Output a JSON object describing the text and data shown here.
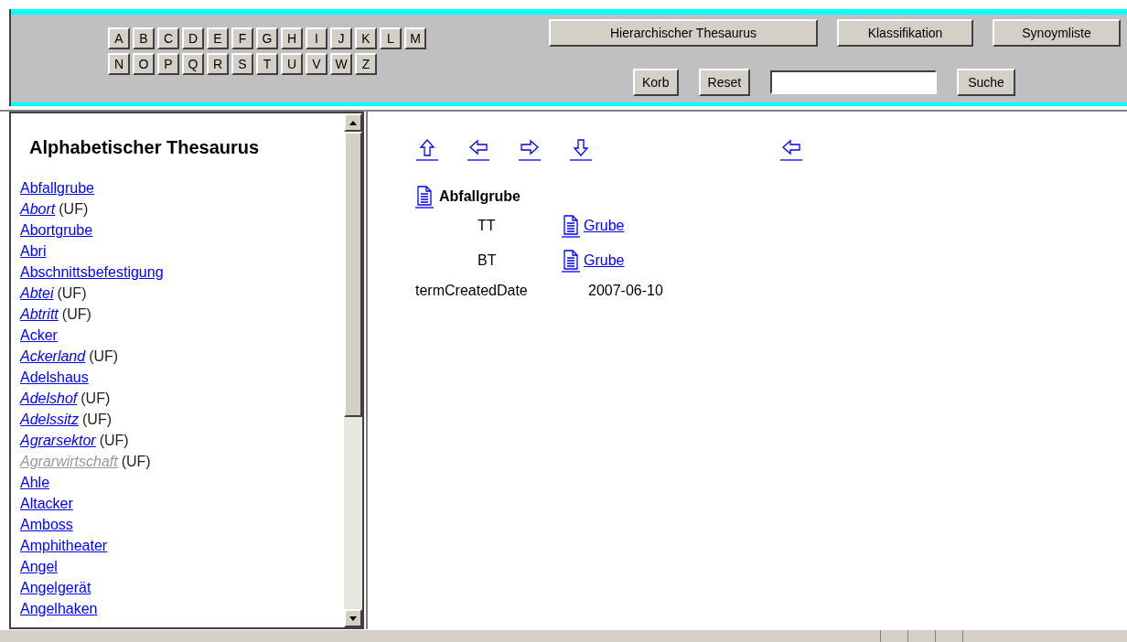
{
  "letters_row_1": [
    "A",
    "B",
    "C",
    "D",
    "E",
    "F",
    "G",
    "H",
    "I",
    "J",
    "K",
    "L",
    "M"
  ],
  "letters_row_2": [
    "N",
    "O",
    "P",
    "Q",
    "R",
    "S",
    "T",
    "U",
    "V",
    "W",
    "Z"
  ],
  "view_buttons": [
    "Hierarchischer Thesaurus",
    "Klassifikation",
    "Synoymliste"
  ],
  "tool_buttons": [
    "Korb",
    "Reset"
  ],
  "search": {
    "button": "Suche"
  },
  "sidebar": {
    "title": "Alphabetischer Thesaurus",
    "items": [
      {
        "label": "Abfallgrube",
        "kind": "preferred",
        "visited": false
      },
      {
        "label": "Abort",
        "kind": "non_preferred",
        "suffix": "(UF)",
        "visited": false
      },
      {
        "label": "Abortgrube",
        "kind": "preferred",
        "visited": false
      },
      {
        "label": "Abri",
        "kind": "preferred",
        "visited": false
      },
      {
        "label": "Abschnittsbefestigung",
        "kind": "preferred",
        "visited": false
      },
      {
        "label": "Abtei",
        "kind": "non_preferred",
        "suffix": "(UF)",
        "visited": false
      },
      {
        "label": "Abtritt",
        "kind": "non_preferred",
        "suffix": "(UF)",
        "visited": false
      },
      {
        "label": "Acker",
        "kind": "preferred",
        "visited": false
      },
      {
        "label": "Ackerland",
        "kind": "non_preferred",
        "suffix": "(UF)",
        "visited": false
      },
      {
        "label": "Adelshaus",
        "kind": "preferred",
        "visited": false
      },
      {
        "label": "Adelshof",
        "kind": "non_preferred",
        "suffix": "(UF)",
        "visited": false
      },
      {
        "label": "Adelssitz",
        "kind": "non_preferred",
        "suffix": "(UF)",
        "visited": false
      },
      {
        "label": "Agrarsektor",
        "kind": "non_preferred",
        "suffix": "(UF)",
        "visited": false
      },
      {
        "label": "Agrarwirtschaft",
        "kind": "non_preferred",
        "suffix": "(UF)",
        "visited": true
      },
      {
        "label": "Ahle",
        "kind": "preferred",
        "visited": false
      },
      {
        "label": "Altacker",
        "kind": "preferred",
        "visited": false
      },
      {
        "label": "Amboss",
        "kind": "preferred",
        "visited": false
      },
      {
        "label": "Amphitheater",
        "kind": "preferred",
        "visited": false
      },
      {
        "label": "Angel",
        "kind": "preferred",
        "visited": false
      },
      {
        "label": "Angelgerät",
        "kind": "preferred",
        "visited": false
      },
      {
        "label": "Angelhaken",
        "kind": "preferred",
        "visited": false
      }
    ]
  },
  "nav": [
    {
      "kind": "up"
    },
    {
      "kind": "left"
    },
    {
      "kind": "right"
    },
    {
      "kind": "down"
    },
    {
      "kind": "back"
    }
  ],
  "term": {
    "title": "Abfallgrube",
    "relations": [
      {
        "type": "TT",
        "target": "Grube"
      },
      {
        "type": "BT",
        "target": "Grube"
      }
    ],
    "fields": [
      {
        "name": "termCreatedDate",
        "value": "2007-06-10"
      }
    ]
  }
}
